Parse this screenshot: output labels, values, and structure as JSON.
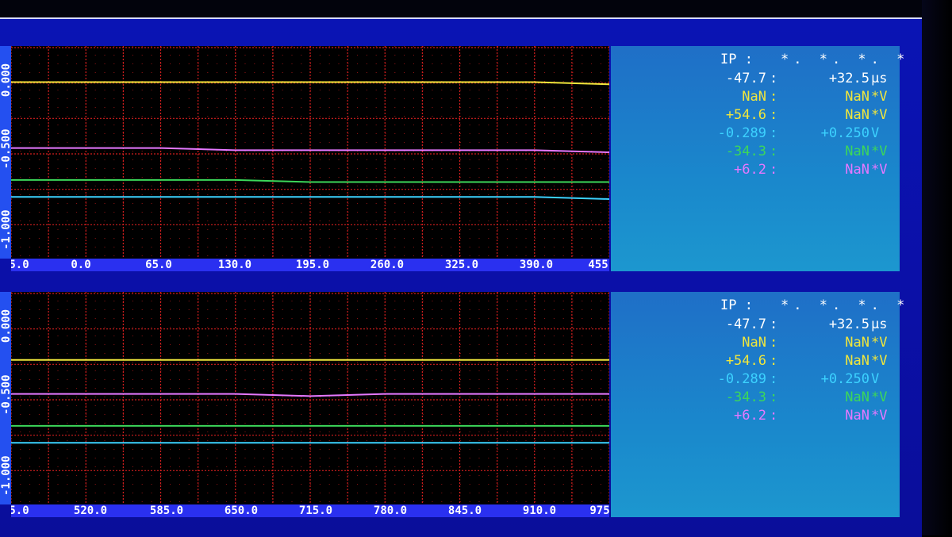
{
  "colors": {
    "white": "#ffffff",
    "yellow": "#f0e63c",
    "cyan": "#3cd2ff",
    "green": "#3cd75a",
    "magenta": "#e678ff",
    "grid": "#d21e1e"
  },
  "panels": [
    {
      "y_ticks": [
        "0.000",
        "-0.500",
        "-1.000"
      ],
      "x_ticks": [
        "5.0",
        "0.0",
        "65.0",
        "130.0",
        "195.0",
        "260.0",
        "325.0",
        "390.0",
        "455"
      ],
      "readout": {
        "ip_label": "IP :",
        "ip_values": "*. *. *. *",
        "rows": [
          {
            "left": "-47.7",
            "right": "+32.5",
            "unit": "μs",
            "color": "white"
          },
          {
            "left": "NaN",
            "right": "NaN",
            "unit": "*V",
            "color": "yellow"
          },
          {
            "left": "+54.6",
            "right": "NaN",
            "unit": "*V",
            "color": "yellow"
          },
          {
            "left": "-0.289",
            "right": "+0.250",
            "unit": "V",
            "color": "cyan"
          },
          {
            "left": "-34.3",
            "right": "NaN",
            "unit": "*V",
            "color": "green"
          },
          {
            "left": "+6.2",
            "right": "NaN",
            "unit": "*V",
            "color": "magenta"
          }
        ]
      }
    },
    {
      "y_ticks": [
        "0.000",
        "-0.500",
        "-1.000"
      ],
      "x_ticks": [
        "5.0",
        "520.0",
        "585.0",
        "650.0",
        "715.0",
        "780.0",
        "845.0",
        "910.0",
        "975"
      ],
      "readout": {
        "ip_label": "IP :",
        "ip_values": "*. *. *. *",
        "rows": [
          {
            "left": "-47.7",
            "right": "+32.5",
            "unit": "μs",
            "color": "white"
          },
          {
            "left": "NaN",
            "right": "NaN",
            "unit": "*V",
            "color": "yellow"
          },
          {
            "left": "+54.6",
            "right": "NaN",
            "unit": "*V",
            "color": "yellow"
          },
          {
            "left": "-0.289",
            "right": "+0.250",
            "unit": "V",
            "color": "cyan"
          },
          {
            "left": "-34.3",
            "right": "NaN",
            "unit": "*V",
            "color": "green"
          },
          {
            "left": "+6.2",
            "right": "NaN",
            "unit": "*V",
            "color": "magenta"
          }
        ]
      }
    }
  ],
  "chart_data": [
    {
      "type": "line",
      "x_tick_labels": [
        "5.0",
        "0.0",
        "65.0",
        "130.0",
        "195.0",
        "260.0",
        "325.0",
        "390.0",
        "455"
      ],
      "y_tick_labels": [
        "0.000",
        "-0.500",
        "-1.000"
      ],
      "ylim": [
        -1.0,
        0.0
      ],
      "grid": true,
      "series": [
        {
          "color": "yellow",
          "values": [
            -0.17,
            -0.17,
            -0.17,
            -0.17,
            -0.17,
            -0.17,
            -0.17,
            -0.17,
            -0.18
          ]
        },
        {
          "color": "magenta",
          "values": [
            -0.48,
            -0.48,
            -0.48,
            -0.49,
            -0.49,
            -0.49,
            -0.49,
            -0.49,
            -0.5
          ]
        },
        {
          "color": "green",
          "values": [
            -0.63,
            -0.63,
            -0.63,
            -0.63,
            -0.64,
            -0.64,
            -0.64,
            -0.64,
            -0.64
          ]
        },
        {
          "color": "cyan",
          "values": [
            -0.71,
            -0.71,
            -0.71,
            -0.71,
            -0.71,
            -0.71,
            -0.71,
            -0.71,
            -0.72
          ]
        }
      ]
    },
    {
      "type": "line",
      "x_tick_labels": [
        "5.0",
        "520.0",
        "585.0",
        "650.0",
        "715.0",
        "780.0",
        "845.0",
        "910.0",
        "975"
      ],
      "y_tick_labels": [
        "0.000",
        "-0.500",
        "-1.000"
      ],
      "ylim": [
        -1.0,
        0.0
      ],
      "grid": true,
      "series": [
        {
          "color": "yellow",
          "values": [
            -0.32,
            -0.32,
            -0.32,
            -0.32,
            -0.32,
            -0.32,
            -0.32,
            -0.32,
            -0.32
          ]
        },
        {
          "color": "magenta",
          "values": [
            -0.48,
            -0.48,
            -0.48,
            -0.48,
            -0.49,
            -0.48,
            -0.48,
            -0.48,
            -0.48
          ]
        },
        {
          "color": "green",
          "values": [
            -0.63,
            -0.63,
            -0.63,
            -0.63,
            -0.63,
            -0.63,
            -0.63,
            -0.63,
            -0.63
          ]
        },
        {
          "color": "cyan",
          "values": [
            -0.71,
            -0.71,
            -0.71,
            -0.71,
            -0.71,
            -0.71,
            -0.71,
            -0.71,
            -0.71
          ]
        }
      ]
    }
  ]
}
